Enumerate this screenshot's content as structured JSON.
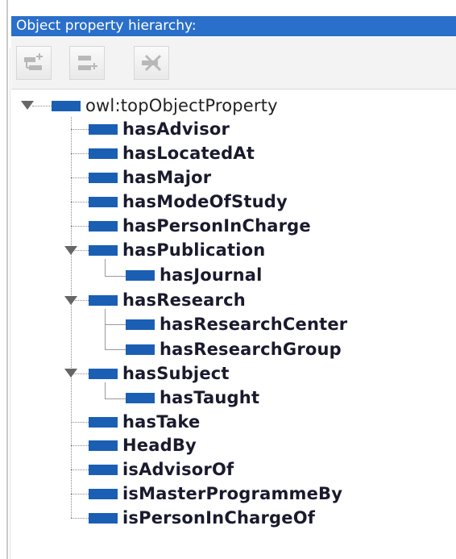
{
  "panel": {
    "title": "Object property hierarchy:",
    "accent_color": "#2a6fc9",
    "property_icon_color": "#1a5fb4"
  },
  "toolbar": {
    "buttons": [
      {
        "icon": "add-sub-property-icon"
      },
      {
        "icon": "add-sibling-property-icon"
      },
      {
        "icon": "delete-property-icon"
      }
    ]
  },
  "tree": {
    "root": "owl:topObjectProperty",
    "items": [
      "hasAdvisor",
      "hasLocatedAt",
      "hasMajor",
      "hasModeOfStudy",
      "hasPersonInCharge",
      "hasPublication",
      "hasJournal",
      "hasResearch",
      "hasResearchCenter",
      "hasResearchGroup",
      "hasSubject",
      "hasTaught",
      "hasTake",
      "HeadBy",
      "isAdvisorOf",
      "isMasterProgrammeBy",
      "isPersonInChargeOf"
    ]
  }
}
